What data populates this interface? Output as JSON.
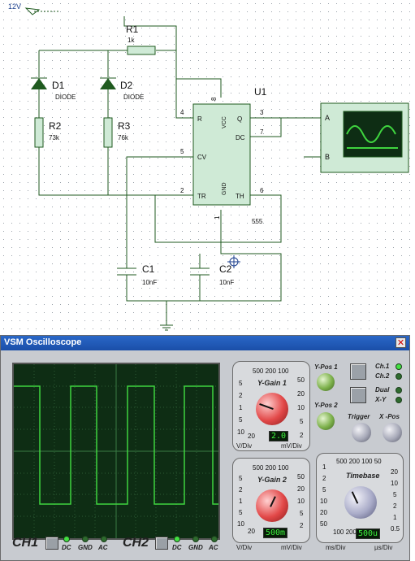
{
  "schematic": {
    "source_label": "12V",
    "resistors": [
      {
        "ref": "R1",
        "value": "1k"
      },
      {
        "ref": "R2",
        "value": "73k"
      },
      {
        "ref": "R3",
        "value": "76k"
      }
    ],
    "diodes": [
      {
        "ref": "D1",
        "value": "DIODE"
      },
      {
        "ref": "D2",
        "value": "DIODE"
      }
    ],
    "capacitors": [
      {
        "ref": "C1",
        "value": "10nF"
      },
      {
        "ref": "C2",
        "value": "10nF"
      }
    ],
    "ic": {
      "ref": "U1",
      "part": "555",
      "pins": {
        "R": "R",
        "VCC": "VCC",
        "Q": "Q",
        "DC": "DC",
        "CV": "CV",
        "TR": "TR",
        "GND": "GND",
        "TH": "TH"
      },
      "pin_numbers": {
        "p4": "4",
        "p8": "8",
        "p3": "3",
        "p7": "7",
        "p5": "5",
        "p2": "2",
        "p1": "1",
        "p6": "6"
      }
    },
    "scope_symbol": {
      "input_a": "A",
      "input_b": "B"
    }
  },
  "oscilloscope": {
    "title": "VSM Oscilloscope",
    "close_glyph": "✕",
    "trace_color": "#3fd43f",
    "ch1_label": "CH1",
    "ch2_label": "CH2",
    "coupling": [
      "DC",
      "GND",
      "AC"
    ],
    "ygain1": {
      "label": "Y-Gain 1",
      "scale_top": "500 200 100",
      "left_ticks": [
        "5",
        "2",
        "1",
        "5",
        "10"
      ],
      "right_ticks": [
        "50",
        "20",
        "10",
        "5",
        "2"
      ],
      "bottom_left": "20",
      "units_left": "V/Div",
      "units_right": "mV/Div",
      "display": "2.0"
    },
    "ygain2": {
      "label": "Y-Gain 2",
      "scale_top": "500 200 100",
      "left_ticks": [
        "5",
        "2",
        "1",
        "5",
        "10"
      ],
      "right_ticks": [
        "50",
        "20",
        "10",
        "5",
        "2"
      ],
      "bottom_left": "20",
      "units_left": "V/Div",
      "units_right": "mV/Div",
      "display": "500m"
    },
    "ypos1_label": "Y-Pos 1",
    "ypos2_label": "Y-Pos 2",
    "ch_select": {
      "ch1": "Ch.1",
      "ch2": "Ch.2",
      "dual": "Dual",
      "xy": "X-Y"
    },
    "trigger_label": "Trigger",
    "xpos_label": "X -Pos",
    "timebase": {
      "label": "Timebase",
      "scale_top": "500 200 100 50",
      "left_ticks": [
        "1",
        "2",
        "5",
        "10",
        "20",
        "50"
      ],
      "right_ticks": [
        "20",
        "10",
        "5",
        "2",
        "1",
        "0.5"
      ],
      "bottom_left": "100 200",
      "units_left": "ms/Div",
      "units_right": "µs/Div",
      "display": "500u"
    }
  }
}
